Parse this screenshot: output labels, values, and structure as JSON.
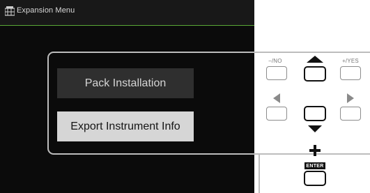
{
  "header": {
    "title": "Expansion Menu",
    "icon": "expansion-menu-icon"
  },
  "menu": {
    "items": [
      {
        "label": "Pack Installation",
        "state": "normal"
      },
      {
        "label": "Export Instrument Info",
        "state": "selected"
      }
    ]
  },
  "panel": {
    "no_label": "−/NO",
    "yes_label": "+/YES",
    "enter_label": "ENTER",
    "icons": [
      "up-arrow-icon",
      "left-arrow-icon",
      "right-arrow-icon",
      "down-arrow-icon",
      "plus-icon"
    ]
  },
  "colors": {
    "screen_bg": "#0b0b0b",
    "titlebar_bg": "#181818",
    "accent_line": "#5aa836",
    "selected_item_bg": "#d6d6d6",
    "normal_item_bg": "#2f2f2f"
  }
}
